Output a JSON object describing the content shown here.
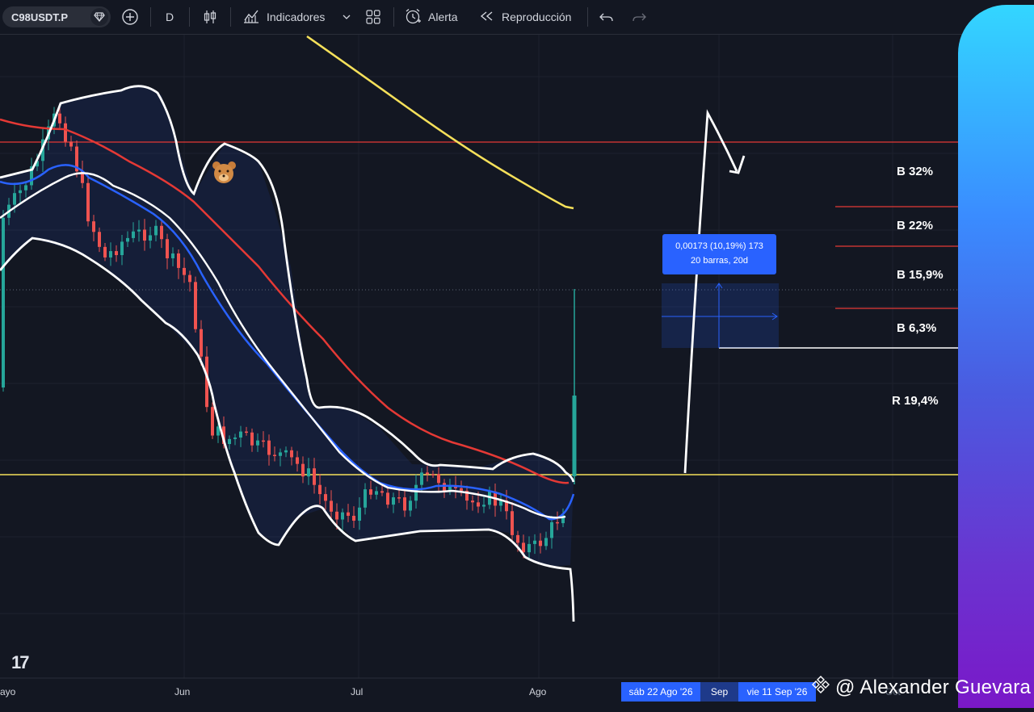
{
  "toolbar": {
    "symbol": "C98USDT.P",
    "interval": "D",
    "indicators_label": "Indicadores",
    "alert_label": "Alerta",
    "replay_label": "Reproducción"
  },
  "colors": {
    "background": "#131722",
    "candle_up": "#26a69a",
    "candle_down": "#ef5350",
    "bollinger": "#ffffff",
    "ma_fast": "#2962ff",
    "ma_slow": "#e53935",
    "ma_long": "#f5e05a",
    "support": "#f5e05a",
    "resistance": "#e53935",
    "accent": "#2962ff"
  },
  "measure": {
    "line1": "0,00173 (10,19%) 173",
    "line2": "20 barras, 20d"
  },
  "targets": {
    "b32": "B 32%",
    "b22": "B 22%",
    "b15": "B 15,9%",
    "b6": "B 6,3%",
    "r19": "R 19,4%"
  },
  "x_axis": {
    "mayo": "ayo",
    "jun": "Jun",
    "jul": "Jul",
    "ago": "Ago",
    "sep": "Sep",
    "oct": "Oct",
    "date_start": "sáb 22 Ago '26",
    "date_end": "vie 11 Sep '26"
  },
  "watermark": "@ Alexander Guevara",
  "logo": "17",
  "chart_data": {
    "type": "candlestick",
    "title": "C98USDT.P",
    "interval": "D",
    "months": [
      "Mayo",
      "Jun",
      "Jul",
      "Ago",
      "Sep",
      "Oct"
    ],
    "trend": "downtrend from Mayo to early Ago, then sharp rally in Ago",
    "indicators": [
      "Bollinger Bands",
      "MA fast (blue)",
      "MA slow (red)",
      "MA long (yellow)"
    ],
    "measure_result": {
      "price_change": "0,00173",
      "percent": "10,19%",
      "bars": 20,
      "days": "20d"
    },
    "annotations": [
      "B 32%",
      "B 22%",
      "B 15,9%",
      "B 6,3%",
      "R 19,4%"
    ],
    "grid": true
  }
}
